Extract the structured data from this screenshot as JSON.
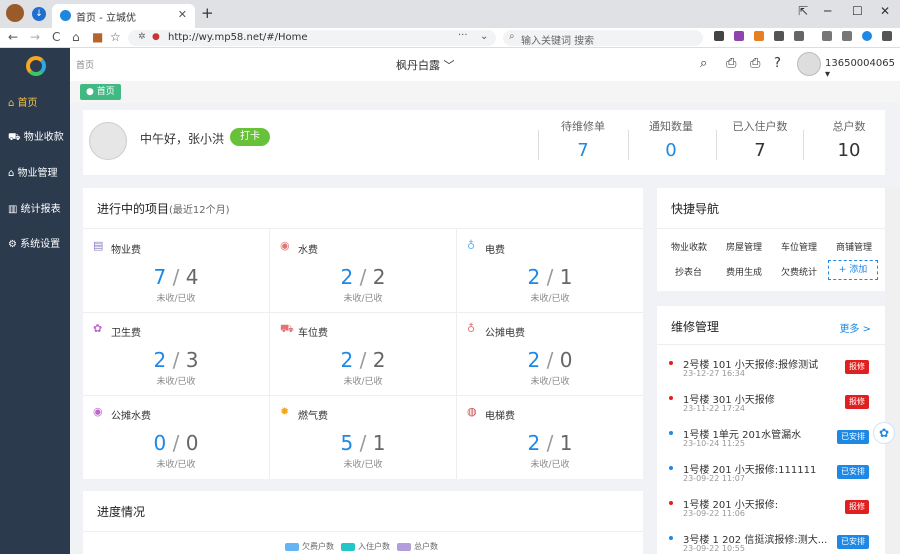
{
  "browser": {
    "tab_title": "首页 - 立城优",
    "tab_close": "✕",
    "new_tab": "+",
    "url": "http://wy.mp58.net/#/Home",
    "url_menu": "···",
    "search_placeholder": "输入关键词 搜索",
    "back": "←",
    "forward": "→",
    "reload": "C",
    "home": "⌂",
    "win_min": "─",
    "win_max": "☐",
    "win_close": "✕",
    "win_restore": "⇱"
  },
  "sidebar": {
    "items": [
      {
        "label": "首页",
        "icon": "home-icon",
        "active": true
      },
      {
        "label": "物业收款",
        "icon": "cart-icon"
      },
      {
        "label": "物业管理",
        "icon": "house-icon"
      },
      {
        "label": "统计报表",
        "icon": "chart-icon"
      },
      {
        "label": "系统设置",
        "icon": "gear-icon"
      }
    ]
  },
  "header": {
    "breadcrumb": "首页",
    "project_select": "枫丹白露 ﹀",
    "account": "13650004065 ▾",
    "icons": [
      "search-icon",
      "print-icon",
      "printer-icon",
      "help-icon"
    ]
  },
  "tags": {
    "home": "● 首页"
  },
  "welcome": {
    "greeting": "中午好，张小洪",
    "status": "打卡",
    "stats": [
      {
        "label": "待维修单",
        "value": "7",
        "blue": true
      },
      {
        "label": "通知数量",
        "value": "0",
        "blue": true
      },
      {
        "label": "已入住户数",
        "value": "7"
      },
      {
        "label": "总户数",
        "value": "10"
      }
    ]
  },
  "projects": {
    "title": "进行中的项目",
    "subtitle": "(最近12个月)",
    "sub_label": "未收/已收",
    "items": [
      {
        "name": "物业费",
        "unpaid": "7",
        "paid": "4",
        "icon": "doc-icon",
        "color": "#8e7cc3"
      },
      {
        "name": "水费",
        "unpaid": "2",
        "paid": "2",
        "icon": "water-icon",
        "color": "#e57373"
      },
      {
        "name": "电费",
        "unpaid": "2",
        "paid": "1",
        "icon": "bulb-icon",
        "color": "#64b5f6"
      },
      {
        "name": "卫生费",
        "unpaid": "2",
        "paid": "3",
        "icon": "clean-icon",
        "color": "#ba68c8"
      },
      {
        "name": "车位费",
        "unpaid": "2",
        "paid": "2",
        "icon": "car-icon",
        "color": "#e57373"
      },
      {
        "name": "公摊电费",
        "unpaid": "2",
        "paid": "0",
        "icon": "bulb-icon",
        "color": "#e57373"
      },
      {
        "name": "公摊水费",
        "unpaid": "0",
        "paid": "0",
        "icon": "water-icon",
        "color": "#ba68c8"
      },
      {
        "name": "燃气费",
        "unpaid": "5",
        "paid": "1",
        "icon": "flame-icon",
        "color": "#f5a623"
      },
      {
        "name": "电梯费",
        "unpaid": "2",
        "paid": "1",
        "icon": "elevator-icon",
        "color": "#c0504d"
      }
    ]
  },
  "progress": {
    "title": "进度情况",
    "legend": [
      {
        "label": "欠费户数",
        "color": "#64b5f6"
      },
      {
        "label": "入住户数",
        "color": "#26c6c6"
      },
      {
        "label": "总户数",
        "color": "#b39ddb"
      }
    ]
  },
  "quick_nav": {
    "title": "快捷导航",
    "links": [
      "物业收款",
      "房屋管理",
      "车位管理",
      "商铺管理",
      "抄表台",
      "费用生成",
      "欠费统计"
    ],
    "add": "+ 添加"
  },
  "repair": {
    "title": "维修管理",
    "more": "更多 >",
    "items": [
      {
        "title": "2号楼 101 小天报修:报修测试",
        "date": "23-12-27 16:34",
        "status": "报修",
        "color": "#e02020",
        "dot": "#e02020"
      },
      {
        "title": "1号楼 301 小天报修",
        "date": "23-11-22 17:24",
        "status": "报修",
        "color": "#e02020",
        "dot": "#e02020"
      },
      {
        "title": "1号楼 1单元 201水管漏水",
        "date": "23-10-24 11:25",
        "status": "已安排",
        "color": "#1e88e5",
        "dot": "#1e88e5"
      },
      {
        "title": "1号楼 201 小天报修:111111",
        "date": "23-09-22 11:07",
        "status": "已安排",
        "color": "#1e88e5",
        "dot": "#1e88e5"
      },
      {
        "title": "1号楼 201 小天报修:",
        "date": "23-09-22 11:06",
        "status": "报修",
        "color": "#e02020",
        "dot": "#e02020"
      },
      {
        "title": "3号楼 1 202 信挺滨报修:测大...",
        "date": "23-09-22 10:55",
        "status": "已安排",
        "color": "#1e88e5",
        "dot": "#1e88e5"
      }
    ]
  }
}
